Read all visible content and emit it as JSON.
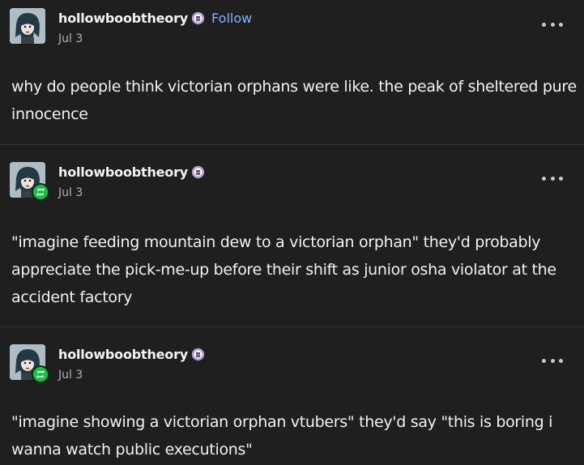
{
  "posts": [
    {
      "username": "hollowboobtheory",
      "follow_label": "Follow",
      "date": "Jul 3",
      "text": "why do people think victorian orphans were like. the peak of sheltered pure innocence",
      "reblog": false
    },
    {
      "username": "hollowboobtheory",
      "date": "Jul 3",
      "text": "\"imagine feeding mountain dew to a victorian orphan\" they'd probably appreciate the pick-me-up before their shift as junior osha violator at the accident factory",
      "reblog": true
    },
    {
      "username": "hollowboobtheory",
      "date": "Jul 3",
      "text": "\"imagine showing a victorian orphan vtubers\" they'd say \"this is boring i wanna watch public executions\"",
      "reblog": true
    }
  ],
  "colors": {
    "background": "#1f1f20",
    "follow": "#7fb3ff",
    "reblog_badge": "#01cf35",
    "badge_icon": "#b49ad8"
  },
  "icons": [
    "avatar",
    "badge-icon",
    "reblog-icon",
    "more-options-icon"
  ]
}
